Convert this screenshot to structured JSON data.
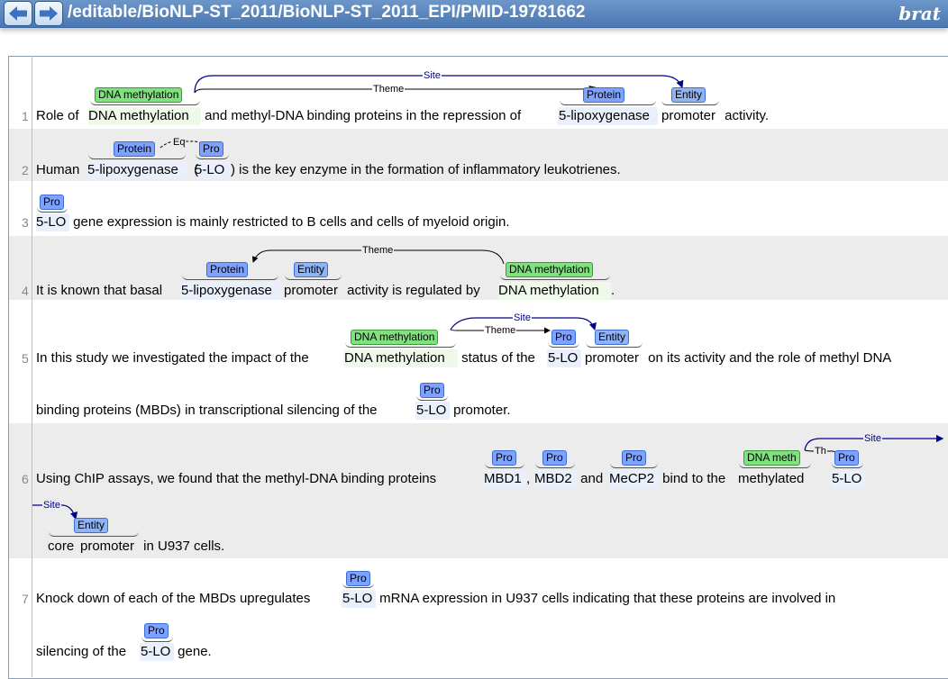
{
  "header": {
    "back_label": "Back",
    "forward_label": "Forward",
    "path": "/editable/BioNLP-ST_2011/BioNLP-ST_2011_EPI/PMID-19781662",
    "logo": "brat"
  },
  "labels": {
    "protein": "Protein",
    "pro": "Pro",
    "entity": "Entity",
    "dna_methylation": "DNA methylation",
    "dna_meth_short": "DNA meth",
    "theme": "Theme",
    "theme_short": "Th",
    "site": "Site",
    "equiv": "Eq"
  },
  "sentences": [
    {
      "num": "1",
      "t": [
        "Role of ",
        "DNA methylation",
        " and methyl-DNA binding proteins in the repression of ",
        "5-lipoxygenase",
        " ",
        "promoter",
        " activity."
      ]
    },
    {
      "num": "2",
      "t": [
        "Human ",
        "5-lipoxygenase",
        " (",
        "5-LO",
        ") is the key enzyme in the formation of inflammatory leukotrienes."
      ]
    },
    {
      "num": "3",
      "t": [
        "5-LO",
        " gene expression is mainly restricted to B cells and cells of myeloid origin."
      ]
    },
    {
      "num": "4",
      "t": [
        "It is known that basal ",
        "5-lipoxygenase",
        " ",
        "promoter",
        " activity is regulated by ",
        "DNA methylation",
        "."
      ]
    },
    {
      "num": "5",
      "t": [
        "In this study we investigated the impact of the ",
        "DNA methylation",
        " status of the ",
        "5-LO",
        " ",
        "promoter",
        " on its activity and the role of methyl DNA"
      ],
      "t2": [
        "binding proteins (MBDs) in transcriptional silencing of the ",
        "5-LO",
        " promoter."
      ]
    },
    {
      "num": "6",
      "t": [
        "Using ChIP assays, we found that the methyl-DNA binding proteins ",
        "MBD1",
        ", ",
        "MBD2",
        " and ",
        "MeCP2",
        " bind to the ",
        "methylated",
        "5-LO"
      ],
      "t2": [
        "core ",
        "promoter",
        " in U937 cells."
      ]
    },
    {
      "num": "7",
      "t": [
        "Knock down of each of the MBDs upregulates ",
        "5-LO",
        " mRNA expression in U937 cells indicating that these proteins are involved in"
      ],
      "t2": [
        "silencing of the ",
        "5-LO",
        " gene."
      ]
    }
  ]
}
